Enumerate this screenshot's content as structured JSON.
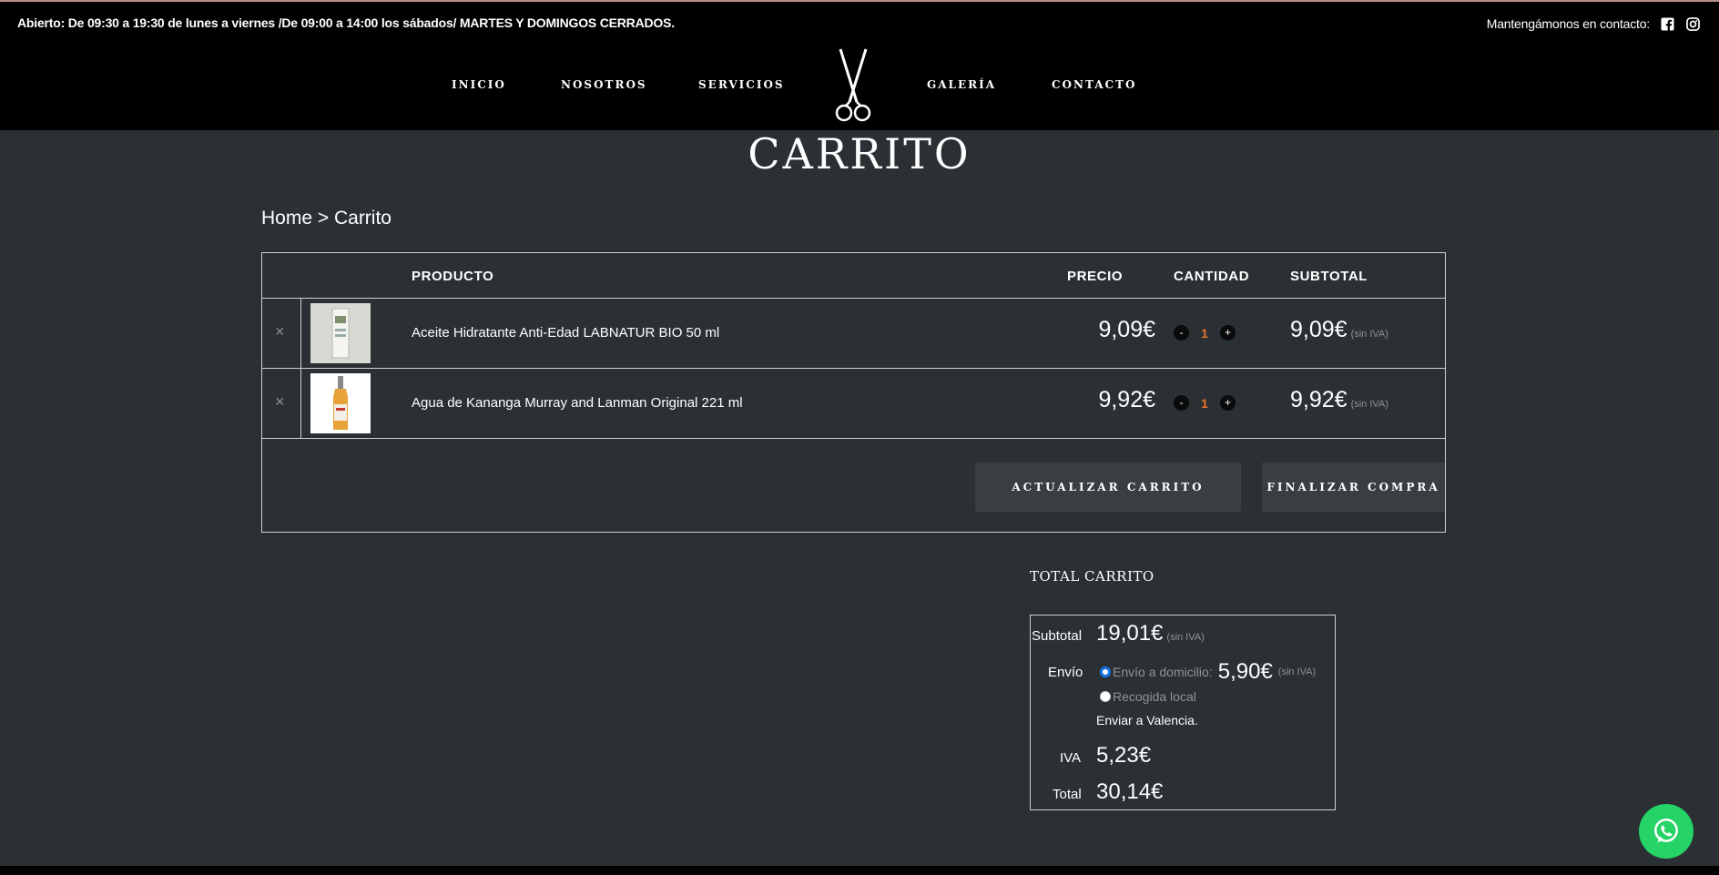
{
  "header": {
    "hours": "Abierto: De 09:30 a 19:30 de lunes a viernes  /De 09:00 a 14:00 los sábados/ MARTES Y DOMINGOS CERRADOS.",
    "contact_label": "Mantengámonos en contacto:",
    "social": [
      "facebook-icon",
      "instagram-icon"
    ]
  },
  "nav": {
    "items": [
      "INICIO",
      "NOSOTROS",
      "SERVICIOS",
      "GALERÍA",
      "CONTACTO"
    ],
    "logo": "scissors-icon"
  },
  "page": {
    "title": "CARRITO",
    "breadcrumb": {
      "home": "Home",
      "separator": " > ",
      "current": "Carrito"
    }
  },
  "cart": {
    "headers": {
      "product": "PRODUCTO",
      "price": "PRECIO",
      "quantity": "CANTIDAD",
      "subtotal": "SUBTOTAL"
    },
    "items": [
      {
        "name": "Aceite Hidratante Anti-Edad LABNATUR BIO 50 ml",
        "price": "9,09€",
        "qty": "1",
        "subtotal": "9,09€",
        "tax_note": "(sin IVA)"
      },
      {
        "name": "Agua de Kananga Murray and Lanman Original 221 ml",
        "price": "9,92€",
        "qty": "1",
        "subtotal": "9,92€",
        "tax_note": "(sin IVA)"
      }
    ],
    "remove_symbol": "×",
    "minus": "-",
    "plus": "+",
    "update_button": "ACTUALIZAR CARRITO",
    "checkout_button": "FINALIZAR COMPRA"
  },
  "totals": {
    "title": "TOTAL CARRITO",
    "subtotal_label": "Subtotal",
    "subtotal_value": "19,01€",
    "subtotal_note": "(sin IVA)",
    "shipping_label": "Envío",
    "shipping_home": "Envío a domicilio:",
    "shipping_home_value": "5,90€",
    "shipping_home_note": "(sin IVA)",
    "shipping_pickup": "Recogida local",
    "ship_to": "Enviar a Valencia.",
    "iva_label": "IVA",
    "iva_value": "5,23€",
    "total_label": "Total",
    "total_value": "30,14€"
  },
  "colors": {
    "background": "#2a3033",
    "header": "#000000",
    "qty": "#e9702a",
    "whatsapp": "#25d366"
  }
}
